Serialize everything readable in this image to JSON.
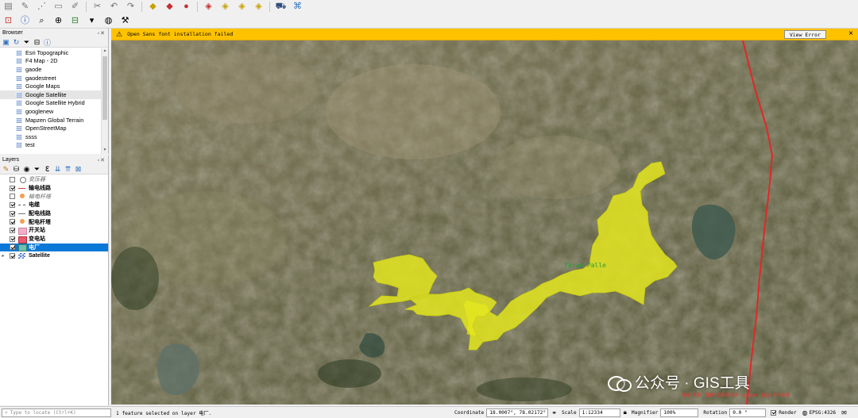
{
  "toolbar": {
    "row1": [
      "new-layer-icon",
      "pencil-icon",
      "vertex-icon",
      "select-icon",
      "digitize-icon",
      "delete-icon",
      "undo-icon",
      "redo-icon",
      "label-icon",
      "label2-icon",
      "pin-icon",
      "label3-icon",
      "label4-icon",
      "label5-icon",
      "label6-icon",
      "car-icon",
      "python-icon"
    ],
    "row2": [
      "identify-icon",
      "info-icon",
      "magnifier-icon",
      "zoom-icon",
      "zoom-out-icon",
      "select-tool-icon",
      "globe-icon",
      "tools-icon"
    ]
  },
  "browser": {
    "title": "Browser",
    "items": [
      {
        "label": "Esri Topographic"
      },
      {
        "label": "F4 Map - 2D"
      },
      {
        "label": "gaode"
      },
      {
        "label": "gaodestreet"
      },
      {
        "label": "Google Maps"
      },
      {
        "label": "Google Satellite",
        "selected": true
      },
      {
        "label": "Google Satellite Hybrid"
      },
      {
        "label": "googlenew"
      },
      {
        "label": "Mapzen Global Terrain"
      },
      {
        "label": "OpenStreetMap"
      },
      {
        "label": "ssss"
      },
      {
        "label": "test"
      }
    ]
  },
  "layers": {
    "title": "Layers",
    "items": [
      {
        "label": "变压器",
        "checked": false,
        "symbol": "circle",
        "style": "italic"
      },
      {
        "label": "输电线路",
        "checked": true,
        "symbol": "line-red",
        "style": "bold"
      },
      {
        "label": "输电杆塔",
        "checked": false,
        "symbol": "dot-orange",
        "style": "italic"
      },
      {
        "label": "电缆",
        "checked": true,
        "symbol": "line-dashed",
        "style": "bold"
      },
      {
        "label": "配电线路",
        "checked": true,
        "symbol": "line-gray",
        "style": "bold"
      },
      {
        "label": "配电杆塔",
        "checked": true,
        "symbol": "dot-orange",
        "style": "bold"
      },
      {
        "label": "开关站",
        "checked": true,
        "symbol": "rect-pink",
        "style": "bold"
      },
      {
        "label": "变电站",
        "checked": true,
        "symbol": "rect-red",
        "style": "bold"
      },
      {
        "label": "电厂",
        "checked": true,
        "symbol": "rect-teal",
        "style": "bold",
        "selected": true
      },
      {
        "label": "Satellite",
        "checked": true,
        "symbol": "raster",
        "style": "bold",
        "expander": true
      }
    ]
  },
  "message_bar": {
    "text": "Open Sans font installation failed",
    "button": "View Error",
    "color": "#ffc200"
  },
  "map": {
    "feature_label": "Taran Palle",
    "polygon_color": "#e3e61e",
    "line_color": "#e02828",
    "watermark": "公众号 · GIS工具",
    "watermark_sub": "作者: 天阳 · 微信: 原来的工作 · gistools · 备注: 合作交流"
  },
  "status": {
    "locator_placeholder": "Type to locate (Ctrl+K)",
    "message": "1 feature selected on layer 电厂.",
    "coordinate_label": "Coordinate",
    "coordinate": "18.0007°, 78.02172°",
    "scale_label": "Scale",
    "scale": "1:12334",
    "magnifier_label": "Magnifier",
    "magnifier": "100%",
    "rotation_label": "Rotation",
    "rotation": "0.0 °",
    "render_label": "Render",
    "crs": "EPSG:4326"
  }
}
